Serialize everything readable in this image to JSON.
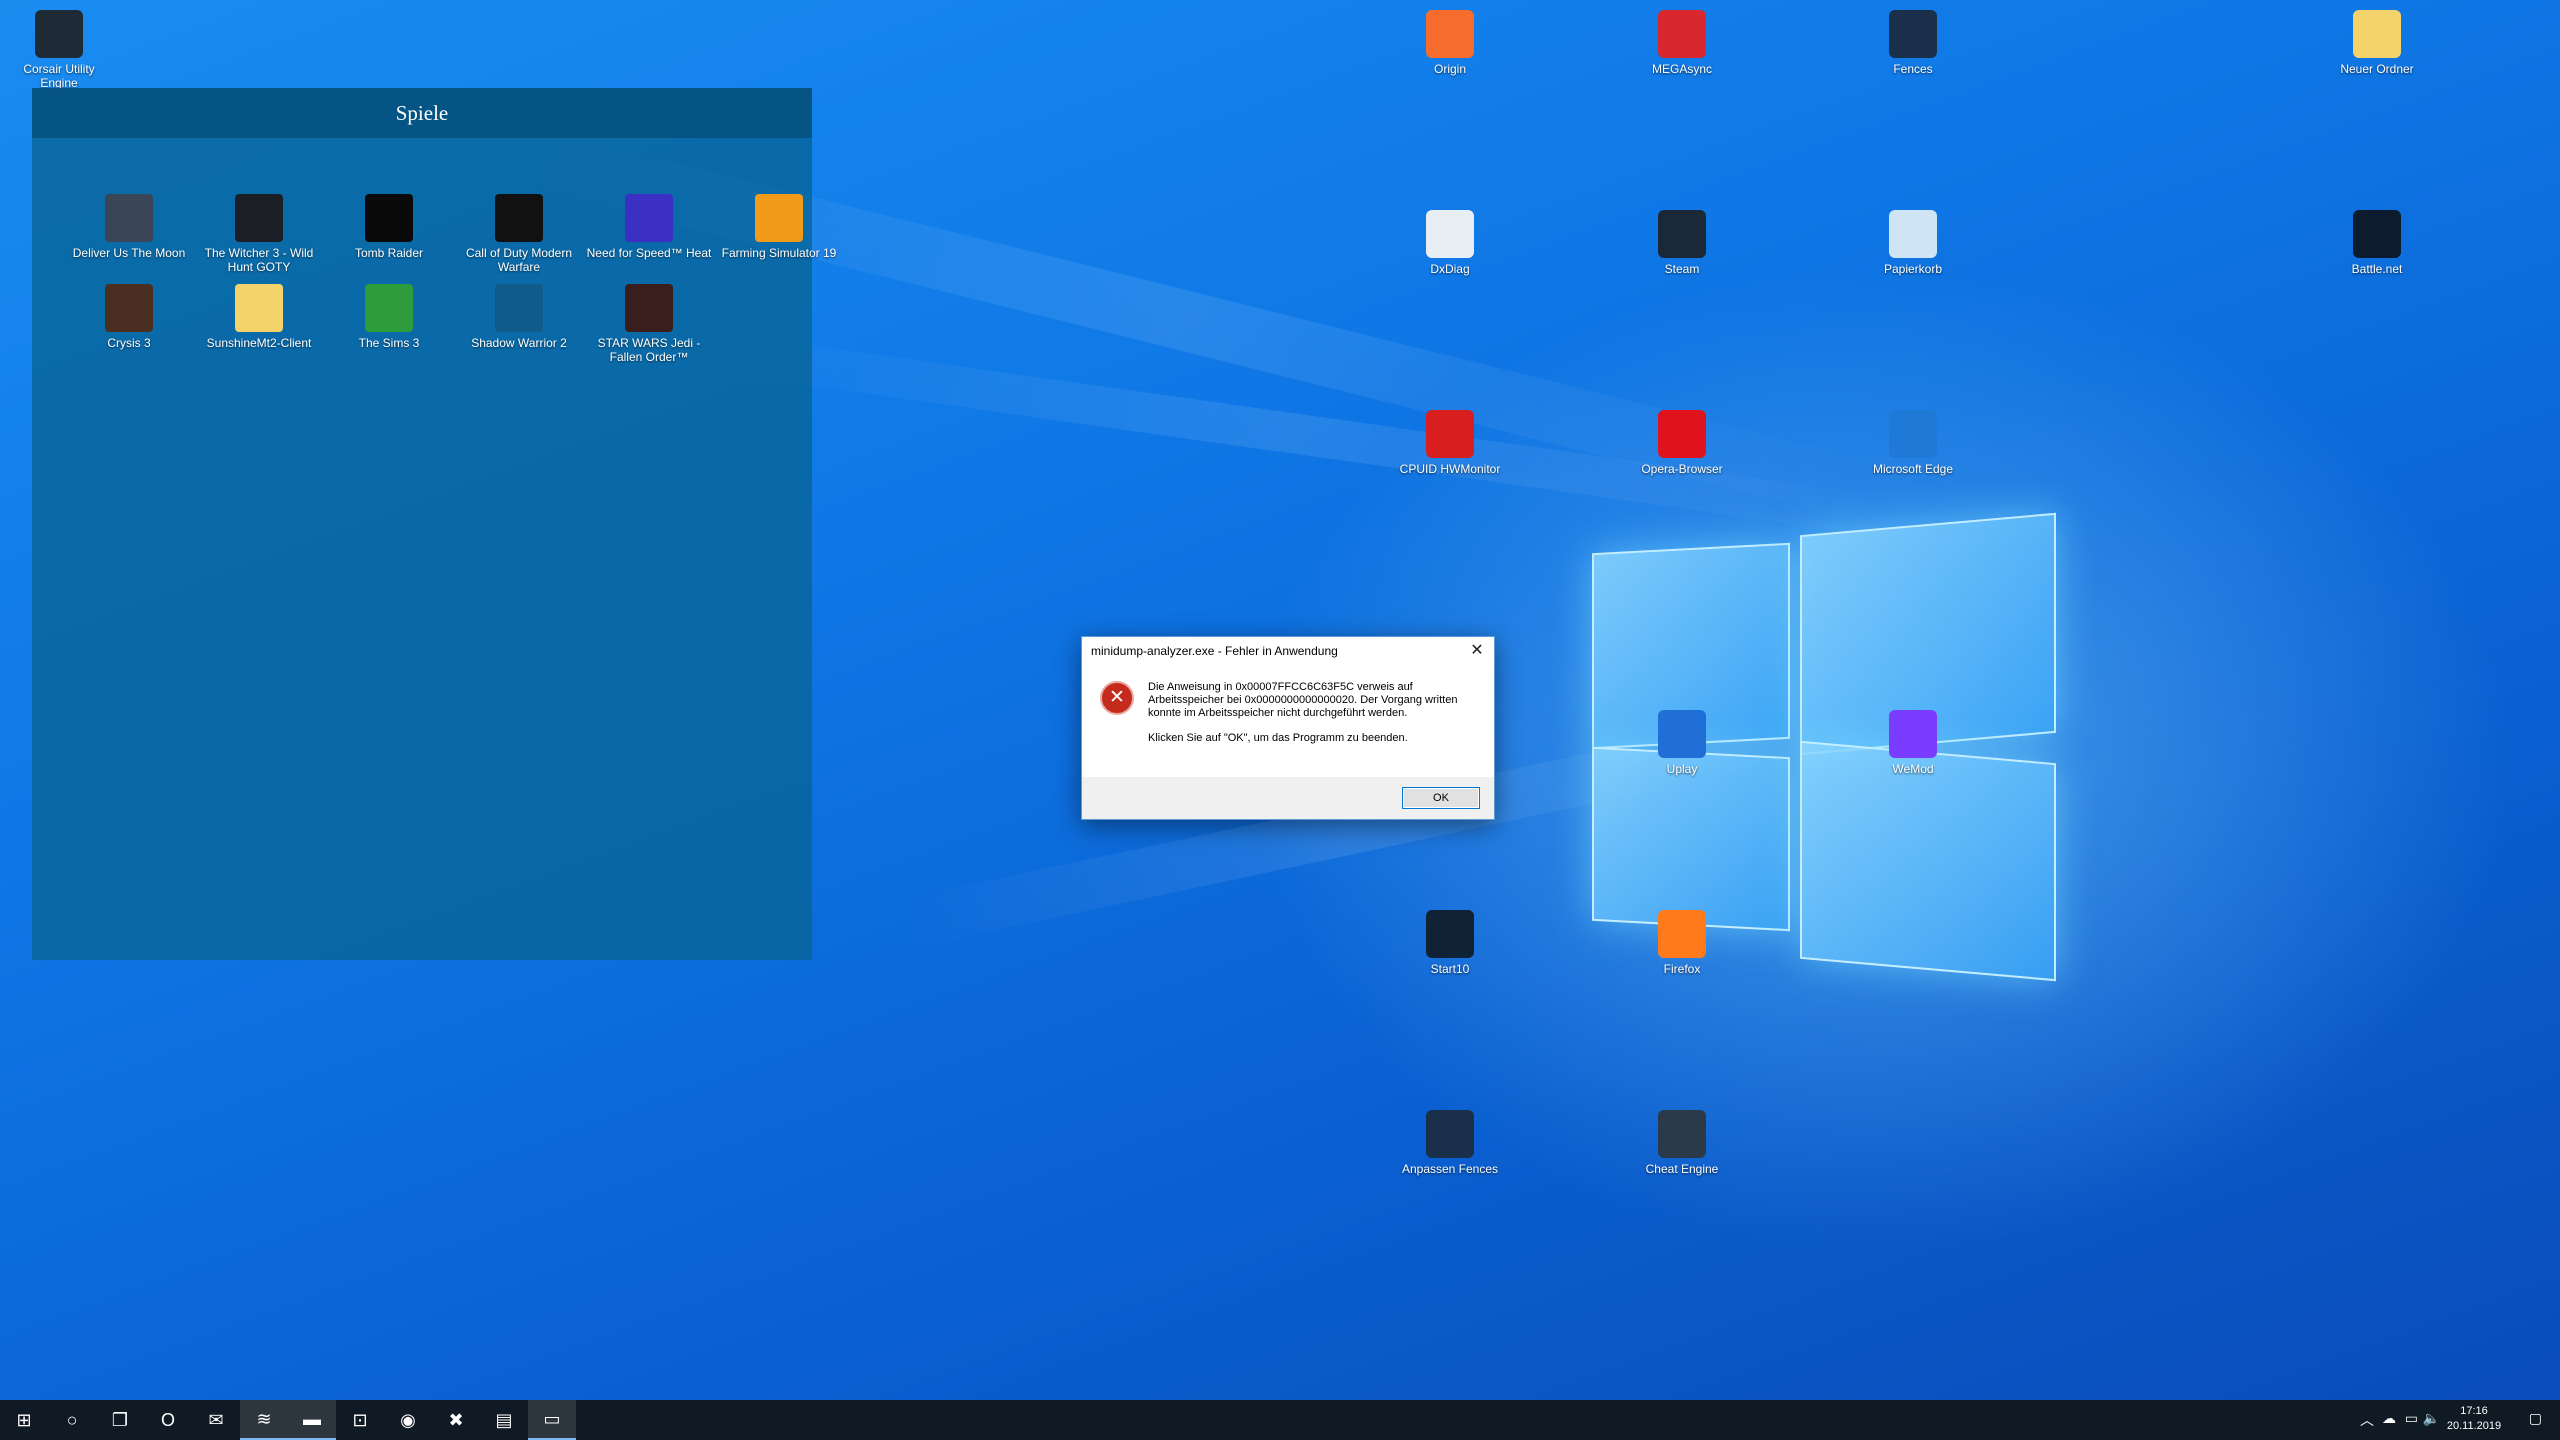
{
  "desktop": {
    "icons": [
      {
        "id": "corsair",
        "label": "Corsair Utility Engine",
        "icon": "corsair-icon",
        "color": "#1e2a36"
      },
      {
        "id": "origin",
        "label": "Origin",
        "icon": "origin-icon",
        "color": "#f56c2d"
      },
      {
        "id": "megasync",
        "label": "MEGAsync",
        "icon": "mega-icon",
        "color": "#d9272e"
      },
      {
        "id": "fences",
        "label": "Fences",
        "icon": "fences-icon",
        "color": "#1a2f4a"
      },
      {
        "id": "neuer-ordner",
        "label": "Neuer Ordner",
        "icon": "folder-icon",
        "color": "#f5d36b"
      },
      {
        "id": "dxdiag",
        "label": "DxDiag",
        "icon": "document-icon",
        "color": "#e9eef4"
      },
      {
        "id": "steam",
        "label": "Steam",
        "icon": "steam-icon",
        "color": "#1b2838"
      },
      {
        "id": "papierkorb",
        "label": "Papierkorb",
        "icon": "recycle-bin-icon",
        "color": "#cfe4f5"
      },
      {
        "id": "battlenet",
        "label": "Battle.net",
        "icon": "battlenet-icon",
        "color": "#0d1b2e"
      },
      {
        "id": "cpuid",
        "label": "CPUID HWMonitor",
        "icon": "hwmonitor-icon",
        "color": "#d81e1e"
      },
      {
        "id": "opera",
        "label": "Opera-Browser",
        "icon": "opera-icon",
        "color": "#e0121e"
      },
      {
        "id": "edge",
        "label": "Microsoft Edge",
        "icon": "edge-icon",
        "color": "#1e7ad6"
      },
      {
        "id": "uplay",
        "label": "Uplay",
        "icon": "uplay-icon",
        "color": "#1f6fd6"
      },
      {
        "id": "wemod",
        "label": "WeMod",
        "icon": "wemod-icon",
        "color": "#7a3cff"
      },
      {
        "id": "start10",
        "label": "Start10",
        "icon": "start10-icon",
        "color": "#0f2236"
      },
      {
        "id": "firefox",
        "label": "Firefox",
        "icon": "firefox-icon",
        "color": "#ff7a1a"
      },
      {
        "id": "anpassen-fences",
        "label": "Anpassen Fences",
        "icon": "fences-icon",
        "color": "#1a2f4a"
      },
      {
        "id": "cheat-engine",
        "label": "Cheat Engine",
        "icon": "cheat-engine-icon",
        "color": "#2a3a4a"
      }
    ]
  },
  "fence": {
    "title": "Spiele",
    "items": [
      {
        "label": "Deliver Us The Moon",
        "icon": "deliver-us-the-moon-icon",
        "color": "#3a4656"
      },
      {
        "label": "The Witcher 3 - Wild Hunt GOTY",
        "icon": "witcher-icon",
        "color": "#1b1f25"
      },
      {
        "label": "Tomb Raider",
        "icon": "tomb-raider-icon",
        "color": "#0a0a0a"
      },
      {
        "label": "Call of Duty Modern Warfare",
        "icon": "cod-mw-icon",
        "color": "#111111"
      },
      {
        "label": "Need for Speed™ Heat",
        "icon": "nfs-icon",
        "color": "#3c2fc4"
      },
      {
        "label": "Farming Simulator 19",
        "icon": "farming-simulator-icon",
        "color": "#f29a1a"
      },
      {
        "label": "Crysis 3",
        "icon": "crysis-icon",
        "color": "#4a2e22"
      },
      {
        "label": "SunshineMt2-Client",
        "icon": "folder-icon",
        "color": "#f5d36b"
      },
      {
        "label": "The Sims 3",
        "icon": "sims-icon",
        "color": "#2e9c3c"
      },
      {
        "label": "Shadow Warrior 2",
        "icon": "shadow-warrior-icon",
        "color": "#0f5c8a"
      },
      {
        "label": "STAR WARS Jedi - Fallen Order™",
        "icon": "jedi-icon",
        "color": "#3a1e1e"
      }
    ]
  },
  "dialog": {
    "title": "minidump-analyzer.exe - Fehler in Anwendung",
    "close_glyph": "✕",
    "error_glyph": "✕",
    "message_line1": "Die Anweisung in 0x00007FFCC6C63F5C verweis auf Arbeitsspeicher bei 0x0000000000000020. Der Vorgang written konnte im Arbeitsspeicher nicht durchgeführt werden.",
    "message_line2": "Klicken Sie auf \"OK\", um das Programm zu beenden.",
    "ok_label": "OK"
  },
  "taskbar": {
    "buttons": [
      {
        "name": "start-button",
        "glyph": "⊞"
      },
      {
        "name": "search-button",
        "glyph": "○"
      },
      {
        "name": "task-view-button",
        "glyph": "❐"
      },
      {
        "name": "opera-taskbar",
        "glyph": "O"
      },
      {
        "name": "mail-taskbar",
        "glyph": "✉"
      },
      {
        "name": "spotify-taskbar",
        "glyph": "≋"
      },
      {
        "name": "explorer-taskbar",
        "glyph": "▬"
      },
      {
        "name": "store-taskbar",
        "glyph": "⊡"
      },
      {
        "name": "firefox-taskbar",
        "glyph": "◉"
      },
      {
        "name": "xbox-taskbar",
        "glyph": "✖"
      },
      {
        "name": "notepad-taskbar",
        "glyph": "▤"
      },
      {
        "name": "app-window-taskbar",
        "glyph": "▭"
      }
    ],
    "clock_time": "17:16",
    "clock_date": "20.11.2019"
  }
}
